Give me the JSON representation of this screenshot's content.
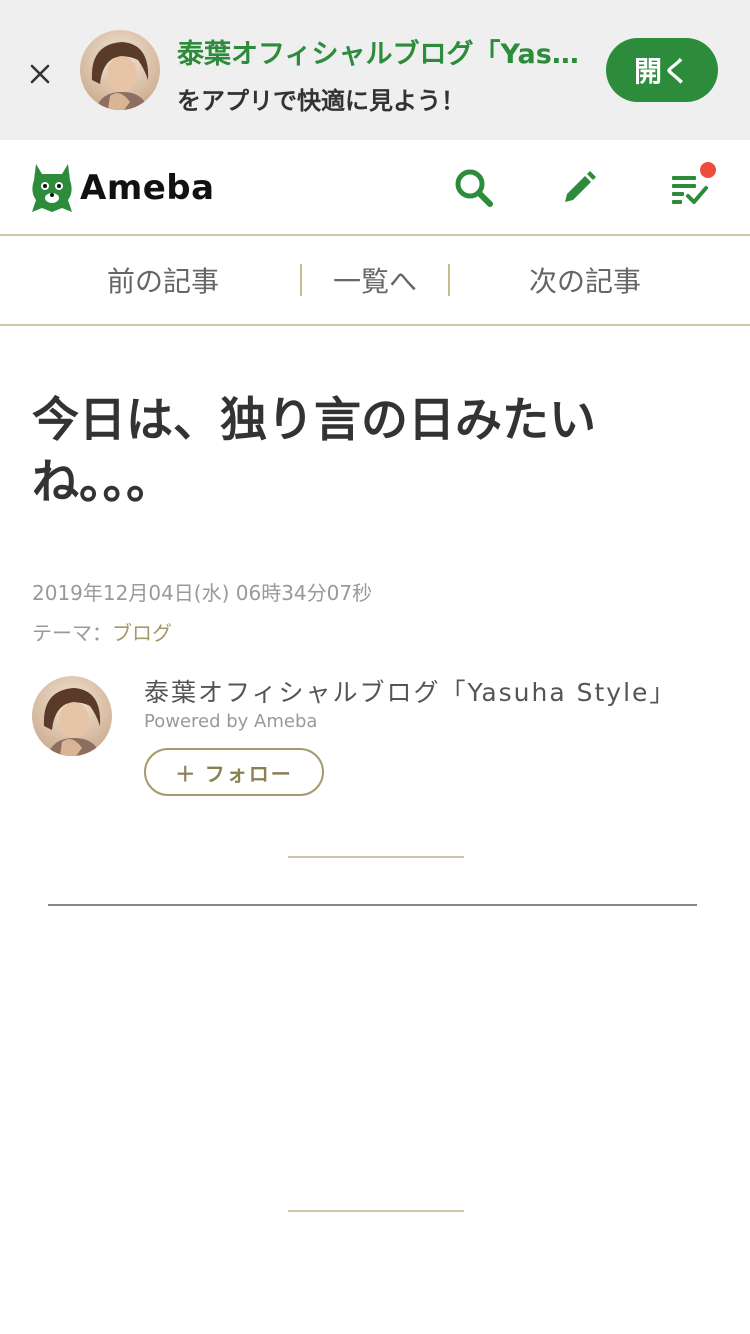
{
  "banner": {
    "title": "泰葉オフィシャルブログ「Yasuha Style」",
    "subtitle": "をアプリで快適に見よう！",
    "open_label": "開く"
  },
  "header": {
    "logo_text": "Ameba",
    "brand_color": "#2d8c3c",
    "notification_color": "#ee4d3d",
    "icons": [
      "search-icon",
      "pencil-icon",
      "checklist-icon"
    ]
  },
  "article_nav": {
    "prev_label": "前の記事",
    "list_label": "一覧へ",
    "next_label": "次の記事"
  },
  "entry": {
    "title": "今日は、独り言の日みたいね。。。",
    "date": "2019年12月04日(水) 06時34分07秒",
    "theme_prefix": "テーマ：",
    "theme_value": "ブログ"
  },
  "profile": {
    "blog_name": "泰葉オフィシャルブログ「Yasuha Style」",
    "powered_by": "Powered by Ameba",
    "follow_label": "＋ フォロー"
  }
}
